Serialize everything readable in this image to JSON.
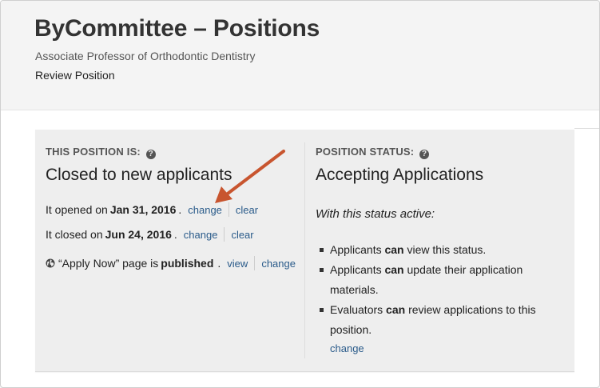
{
  "header": {
    "title": "ByCommittee – Positions",
    "subtitle": "Associate Professor of Orthodontic Dentistry",
    "breadcrumb": "Review Position"
  },
  "position_is": {
    "label": "THIS POSITION IS:",
    "status": "Closed to new applicants",
    "opened_prefix": "It opened on",
    "opened_date": "Jan 31, 2016",
    "closed_prefix": "It closed on",
    "closed_date": "Jun 24, 2016",
    "period": ".",
    "change_label": "change",
    "clear_label": "clear",
    "apply_prefix": "“Apply Now” page is",
    "apply_state": "published",
    "apply_suffix": ".",
    "view_label": "view"
  },
  "position_status": {
    "label": "POSITION STATUS:",
    "status": "Accepting Applications",
    "note": "With this status active:",
    "items": [
      {
        "pre": "Applicants",
        "bold": "can",
        "post": "view this status."
      },
      {
        "pre": "Applicants",
        "bold": "can",
        "post": "update their application materials."
      },
      {
        "pre": "Evaluators",
        "bold": "can",
        "post": "review applications to this position."
      }
    ],
    "change_label": "change"
  },
  "colors": {
    "link": "#2a5b8a",
    "arrow": "#c8552f",
    "panel_bg": "#eeeeee",
    "header_bg": "#f4f4f4"
  },
  "icons": {
    "help": "help-circle-icon",
    "globe": "globe-icon",
    "annotation": "arrow-annotation-icon"
  }
}
